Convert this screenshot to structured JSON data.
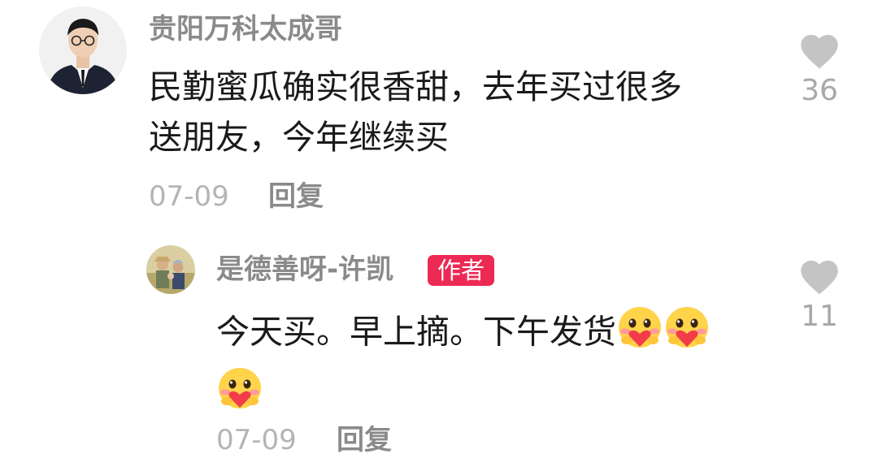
{
  "comments": [
    {
      "username": "贵阳万科太成哥",
      "text_line1": "民勤蜜瓜确实很香甜，去年买过很多",
      "text_line2": "送朋友，今年继续买",
      "date": "07-09",
      "reply_label": "回复",
      "like_count": "36",
      "emojis": []
    },
    {
      "username": "是德善呀-许凯",
      "badge": "作者",
      "text_line1": "今天买。早上摘。下午发货",
      "date": "07-09",
      "reply_label": "回复",
      "like_count": "11",
      "emojis": [
        "hugging-face-emoji",
        "hugging-face-emoji",
        "hugging-face-emoji"
      ]
    }
  ],
  "colors": {
    "username": "#8a8a8a",
    "text": "#1a1a1a",
    "meta": "#b4b4b4",
    "heart": "#c4c4c4",
    "badge": "#ec2a54"
  },
  "icons": {
    "like": "heart-icon"
  }
}
